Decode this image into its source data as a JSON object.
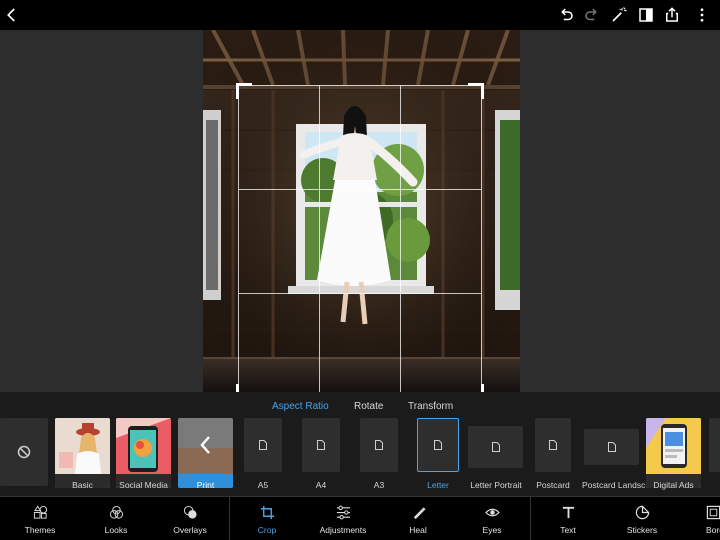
{
  "top_bar": {
    "icons": [
      "back-chevron-icon",
      "undo-icon",
      "redo-icon",
      "magic-wand-icon",
      "compare-icon",
      "share-icon",
      "more-icon"
    ]
  },
  "crop_tabs": [
    {
      "label": "Aspect Ratio",
      "active": true
    },
    {
      "label": "Rotate",
      "active": false
    },
    {
      "label": "Transform",
      "active": false
    }
  ],
  "presets": [
    {
      "label": "",
      "kind": "none"
    },
    {
      "label": "Basic",
      "kind": "photo"
    },
    {
      "label": "Social Media",
      "kind": "social"
    },
    {
      "label": "Print",
      "kind": "print",
      "selected": true
    },
    {
      "label": "A5",
      "kind": "doc"
    },
    {
      "label": "A4",
      "kind": "doc"
    },
    {
      "label": "A3",
      "kind": "doc"
    },
    {
      "label": "Letter",
      "kind": "doc",
      "active": true
    },
    {
      "label": "Letter Portrait",
      "kind": "doc-wide"
    },
    {
      "label": "Postcard",
      "kind": "doc"
    },
    {
      "label": "Postcard Landsc",
      "kind": "doc-wide"
    },
    {
      "label": "Digital Ads",
      "kind": "ads"
    }
  ],
  "tools": [
    {
      "label": "Themes",
      "icon": "themes-icon"
    },
    {
      "label": "Looks",
      "icon": "looks-icon"
    },
    {
      "label": "Overlays",
      "icon": "overlays-icon"
    },
    {
      "label": "Crop",
      "icon": "crop-icon",
      "active": true
    },
    {
      "label": "Adjustments",
      "icon": "adjustments-icon"
    },
    {
      "label": "Heal",
      "icon": "heal-icon"
    },
    {
      "label": "Eyes",
      "icon": "eye-icon"
    },
    {
      "label": "Text",
      "icon": "text-icon"
    },
    {
      "label": "Stickers",
      "icon": "stickers-icon"
    },
    {
      "label": "Bord",
      "icon": "borders-icon"
    }
  ],
  "colors": {
    "accent": "#4aa3e8",
    "selected": "#2f8fd8",
    "toolbar_bg": "#000000",
    "panel_bg": "#1b1b1b"
  }
}
